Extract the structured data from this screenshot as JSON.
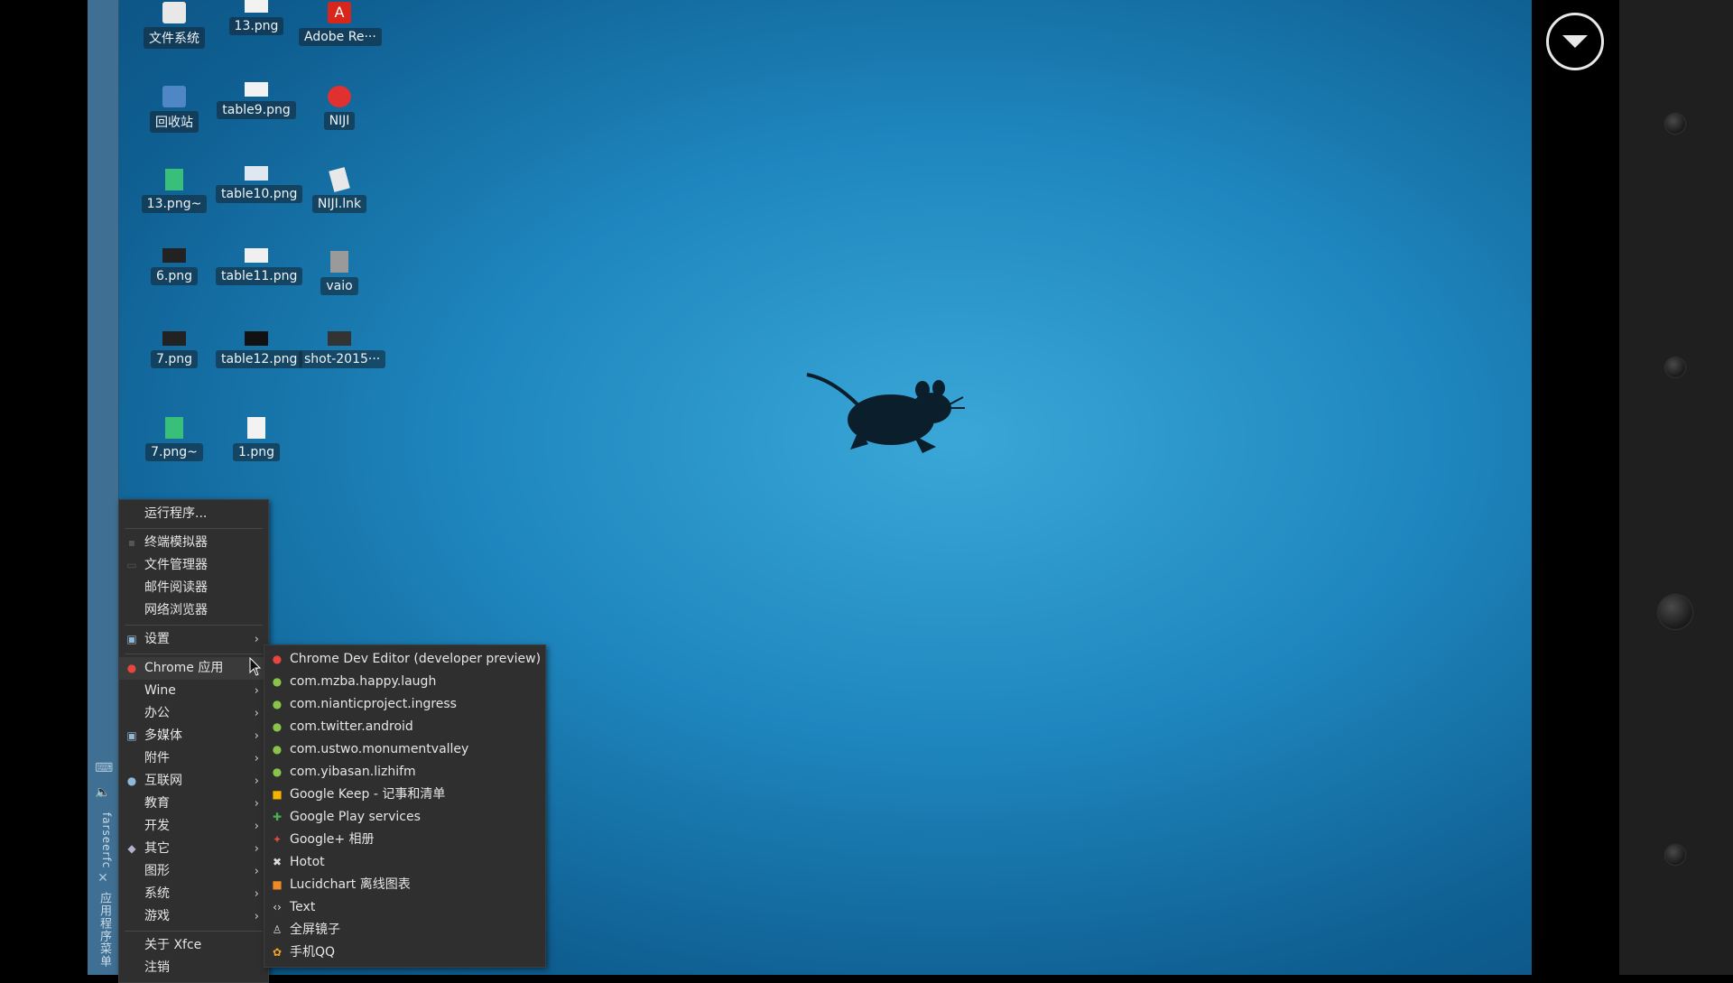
{
  "desktop_icons": [
    {
      "label": "文件系统",
      "color": "#e8e8e8"
    },
    {
      "label": "13.png",
      "color": "#f2f2f2"
    },
    {
      "label": "Adobe Re···",
      "color": "#d9261c"
    },
    {
      "label": "回收站",
      "color": "#4f86c6"
    },
    {
      "label": "table9.png",
      "color": "#f2f2f2"
    },
    {
      "label": "NIJI",
      "color": "#e03030"
    },
    {
      "label": "13.png~",
      "color": "#38c07a"
    },
    {
      "label": "table10.png",
      "color": "#dfe8f0"
    },
    {
      "label": "NIJI.lnk",
      "color": "#e8e8e8"
    },
    {
      "label": "6.png",
      "color": "#222222"
    },
    {
      "label": "table11.png",
      "color": "#f0f0f0"
    },
    {
      "label": "vaio",
      "color": "#9a9a9a"
    },
    {
      "label": "7.png",
      "color": "#222222"
    },
    {
      "label": "table12.png",
      "color": "#111111"
    },
    {
      "label": "shot-2015···",
      "color": "#333333"
    },
    {
      "label": "7.png~",
      "color": "#38c07a"
    },
    {
      "label": "1.png",
      "color": "#f2f2f2"
    }
  ],
  "panel": {
    "vertical_label": "farseerfc",
    "apps_menu_label": "应用程序菜单"
  },
  "main_menu": {
    "items": [
      {
        "label": "运行程序...",
        "icon": "run-icon"
      },
      {
        "label": "终端模拟器",
        "icon": "terminal-icon"
      },
      {
        "label": "文件管理器",
        "icon": "file-manager-icon"
      },
      {
        "label": "邮件阅读器",
        "icon": "mail-icon"
      },
      {
        "label": "网络浏览器",
        "icon": "browser-icon"
      },
      {
        "label": "设置",
        "icon": "settings-icon",
        "submenu": true
      },
      {
        "label": "Chrome 应用",
        "icon": "chrome-icon",
        "submenu": true
      },
      {
        "label": "Wine",
        "icon": "wine-icon",
        "submenu": true
      },
      {
        "label": "办公",
        "icon": "office-icon",
        "submenu": true
      },
      {
        "label": "多媒体",
        "icon": "multimedia-icon",
        "submenu": true
      },
      {
        "label": "附件",
        "icon": "accessories-icon",
        "submenu": true
      },
      {
        "label": "互联网",
        "icon": "internet-icon",
        "submenu": true
      },
      {
        "label": "教育",
        "icon": "education-icon",
        "submenu": true
      },
      {
        "label": "开发",
        "icon": "development-icon",
        "submenu": true
      },
      {
        "label": "其它",
        "icon": "other-icon",
        "submenu": true
      },
      {
        "label": "图形",
        "icon": "graphics-icon",
        "submenu": true
      },
      {
        "label": "系统",
        "icon": "system-icon",
        "submenu": true
      },
      {
        "label": "游戏",
        "icon": "games-icon",
        "submenu": true
      },
      {
        "label": "关于 Xfce",
        "icon": "about-icon"
      },
      {
        "label": "注销",
        "icon": "logout-icon"
      }
    ]
  },
  "chrome_submenu": {
    "items": [
      {
        "label": "Chrome Dev Editor (developer preview)",
        "icon": "chrome-icon",
        "color": "#e8453c"
      },
      {
        "label": "com.mzba.happy.laugh",
        "icon": "android-icon",
        "color": "#8bc34a"
      },
      {
        "label": "com.nianticproject.ingress",
        "icon": "android-icon",
        "color": "#8bc34a"
      },
      {
        "label": "com.twitter.android",
        "icon": "android-icon",
        "color": "#8bc34a"
      },
      {
        "label": "com.ustwo.monumentvalley",
        "icon": "android-icon",
        "color": "#8bc34a"
      },
      {
        "label": "com.yibasan.lizhifm",
        "icon": "android-icon",
        "color": "#8bc34a"
      },
      {
        "label": "Google Keep - 记事和清单",
        "icon": "keep-icon",
        "color": "#f4b400"
      },
      {
        "label": "Google Play services",
        "icon": "play-services-icon",
        "color": "#4caf50"
      },
      {
        "label": "Google+ 相册",
        "icon": "photos-icon",
        "color": "#dd4b39"
      },
      {
        "label": "Hotot",
        "icon": "hotot-icon",
        "color": "#dddddd"
      },
      {
        "label": "Lucidchart 离线图表",
        "icon": "lucidchart-icon",
        "color": "#f08a24"
      },
      {
        "label": "Text",
        "icon": "text-icon",
        "color": "#e0e0e0"
      },
      {
        "label": "全屏镜子",
        "icon": "mirror-icon",
        "color": "#dddddd"
      },
      {
        "label": "手机QQ",
        "icon": "qq-icon",
        "color": "#f5a623"
      }
    ]
  }
}
